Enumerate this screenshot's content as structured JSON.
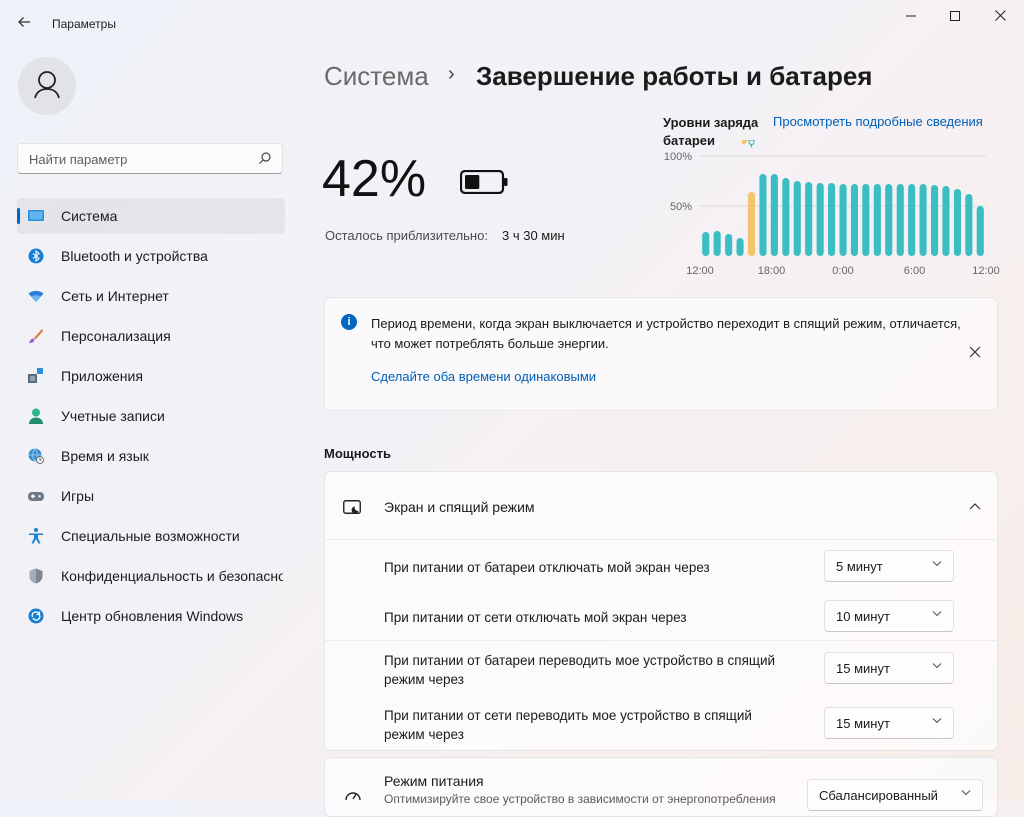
{
  "window": {
    "title": "Параметры",
    "back_icon": "arrow-left",
    "minimize_glyph": "–",
    "maximize_glyph": "☐",
    "close_glyph": "✕"
  },
  "sidebar": {
    "search": {
      "placeholder": "Найти параметр"
    },
    "items": [
      {
        "label": "Система",
        "icon": "monitor-icon",
        "active": true
      },
      {
        "label": "Bluetooth и устройства",
        "icon": "bluetooth-icon"
      },
      {
        "label": "Сеть и Интернет",
        "icon": "wifi-icon"
      },
      {
        "label": "Персонализация",
        "icon": "brush-icon"
      },
      {
        "label": "Приложения",
        "icon": "apps-icon"
      },
      {
        "label": "Учетные записи",
        "icon": "person-icon"
      },
      {
        "label": "Время и язык",
        "icon": "globe-clock-icon"
      },
      {
        "label": "Игры",
        "icon": "gamepad-icon"
      },
      {
        "label": "Специальные возможности",
        "icon": "accessibility-icon"
      },
      {
        "label": "Конфиденциальность и безопасность",
        "icon": "shield-icon"
      },
      {
        "label": "Центр обновления Windows",
        "icon": "update-icon"
      }
    ]
  },
  "breadcrumb": {
    "parent": "Система",
    "separator": "›",
    "current": "Завершение работы и батарея"
  },
  "battery": {
    "percent": "42%",
    "level": 0.42,
    "remaining_label": "Осталось приблизительно:",
    "remaining_value": "3 ч 30 мин"
  },
  "chart_title": "Уровни заряда батареи",
  "chart_link": "Просмотреть подробные сведения",
  "chart_data": {
    "type": "bar",
    "title": "Уровни заряда батареи",
    "y_tick_labels": [
      "100%",
      "50%"
    ],
    "ylim": [
      0,
      100
    ],
    "x_tick_labels": [
      "12:00",
      "18:00",
      "0:00",
      "6:00",
      "12:00"
    ],
    "values": [
      24,
      25,
      22,
      18,
      64,
      82,
      82,
      78,
      75,
      74,
      73,
      73,
      72,
      72,
      72,
      72,
      72,
      72,
      72,
      72,
      71,
      70,
      67,
      62,
      50
    ],
    "charging_index": 4,
    "colors": {
      "normal": "#3bbdc4",
      "charging": "#f5c36b",
      "grid": "#dcdcdc",
      "tick_text": "#666666"
    }
  },
  "info_bar": {
    "text": "Период времени, когда экран выключается и устройство переходит в спящий режим, отличается, что может потреблять больше энергии.",
    "link": "Сделайте оба времени одинаковыми"
  },
  "power": {
    "section_title": "Мощность",
    "screen_sleep": {
      "title": "Экран и спящий режим",
      "rows": [
        {
          "label": "При питании от батареи отключать мой экран через",
          "value": "5 минут"
        },
        {
          "label": "При питании от сети отключать мой экран через",
          "value": "10 минут"
        },
        {
          "label": "При питании от батареи переводить мое устройство в спящий режим через",
          "value": "15 минут"
        },
        {
          "label": "При питании от сети переводить мое устройство в спящий режим через",
          "value": "15 минут"
        }
      ]
    },
    "power_mode": {
      "title": "Режим питания",
      "subtitle": "Оптимизируйте свое устройство в зависимости от энергопотребления",
      "value": "Сбалансированный"
    }
  },
  "colors": {
    "accent": "#0067c0",
    "link": "#005fb8"
  }
}
